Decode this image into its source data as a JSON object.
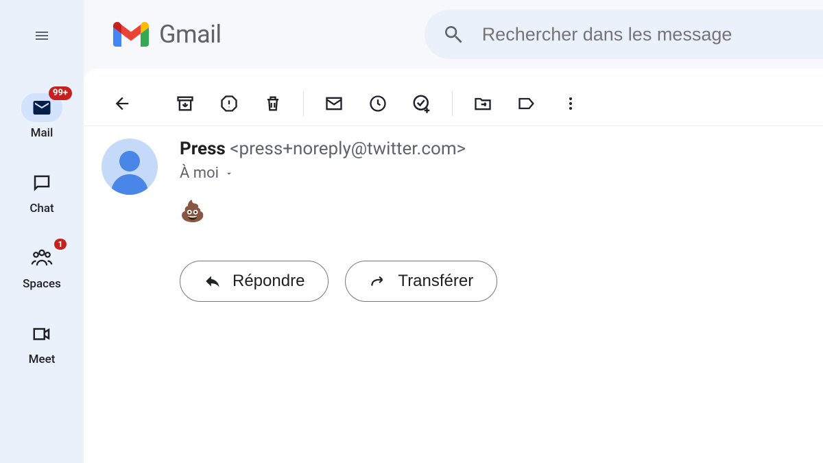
{
  "app": {
    "name": "Gmail"
  },
  "search": {
    "placeholder": "Rechercher dans les message"
  },
  "nav": {
    "items": [
      {
        "label": "Mail",
        "badge": "99+"
      },
      {
        "label": "Chat",
        "badge": null
      },
      {
        "label": "Spaces",
        "badge": "1"
      },
      {
        "label": "Meet",
        "badge": null
      }
    ]
  },
  "email": {
    "sender_name": "Press",
    "sender_email": "<press+noreply@twitter.com>",
    "to_line": "À moi",
    "body": "💩"
  },
  "actions": {
    "reply": "Répondre",
    "forward": "Transférer"
  }
}
